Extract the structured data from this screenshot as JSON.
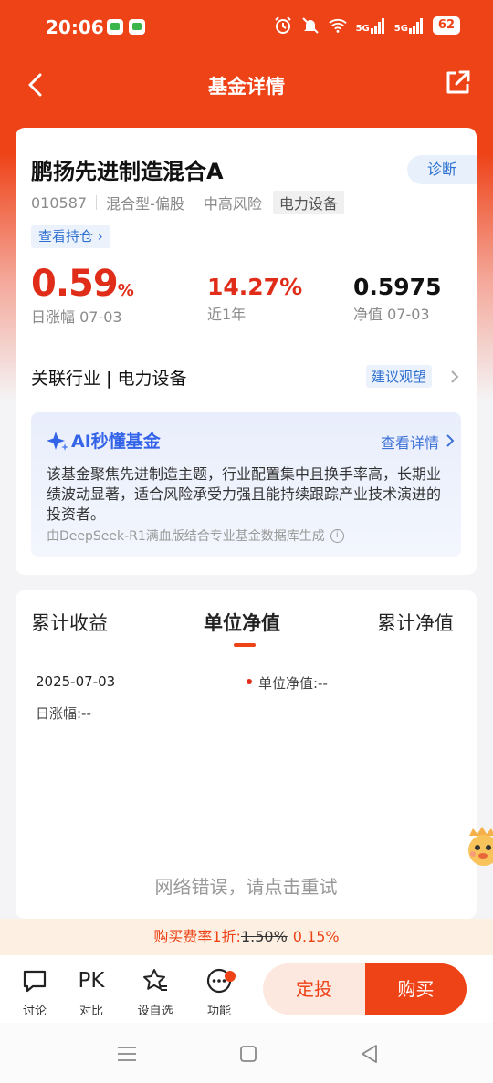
{
  "status_bar": {
    "time": "20:06",
    "signal_1": "5G",
    "signal_2": "5G",
    "battery": "62"
  },
  "nav": {
    "title": "基金详情"
  },
  "fund": {
    "name": "鹏扬先进制造混合A",
    "diagnose_label": "诊断",
    "code": "010587",
    "type": "混合型-偏股",
    "risk": "中高风险",
    "sector_tag": "电力设备",
    "holdings_label": "查看持仓 ›",
    "daily_change_value": "0.59",
    "daily_change_unit": "%",
    "daily_change_label": "日涨幅 07-03",
    "yearly_return_value": "14.27%",
    "yearly_return_label": "近1年",
    "nav_value": "0.5975",
    "nav_label": "净值 07-03",
    "industry_text": "关联行业 | 电力设备",
    "advice_label": "建议观望"
  },
  "ai": {
    "title": "AI秒懂基金",
    "detail_label": "查看详情",
    "summary": "该基金聚焦先进制造主题，行业配置集中且换手率高，长期业绩波动显著，适合风险承受力强且能持续跟踪产业技术演进的投资者。",
    "footer": "由DeepSeek-R1满血版结合专业基金数据库生成",
    "accent": "#3363e8"
  },
  "chart": {
    "tabs": [
      "累计收益",
      "单位净值",
      "累计净值"
    ],
    "active_tab": "单位净值",
    "date": "2025-07-03",
    "nav_label": "单位净值:--",
    "change_label": "日涨幅:--",
    "error": "网络错误，请点击重试"
  },
  "fee": {
    "prefix": "购买费率1折:",
    "old_rate": "1.50%",
    "new_rate": "0.15%"
  },
  "bottom_bar": {
    "discuss": "讨论",
    "pk_icon_text": "PK",
    "compare": "对比",
    "watchlist": "设自选",
    "functions": "功能",
    "dingtou": "定投",
    "buy": "购买"
  },
  "colors": {
    "brand": "#ee4217",
    "up_red": "#e02d1a",
    "link_blue": "#2c6fcf"
  }
}
